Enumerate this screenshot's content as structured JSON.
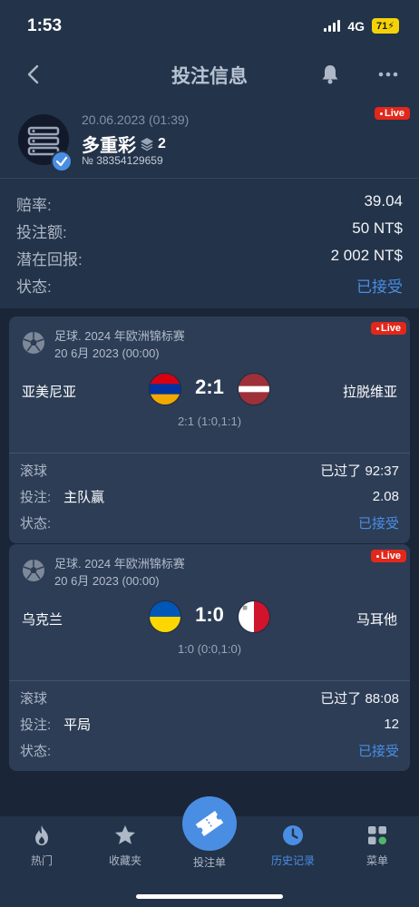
{
  "status_bar": {
    "time": "1:53",
    "network": "4G",
    "battery": "71"
  },
  "nav": {
    "title": "投注信息"
  },
  "colors": {
    "accent": "#4a8ee4",
    "live": "#e2281a",
    "background": "#1a2538",
    "panel": "#233349",
    "card": "#2d3d56"
  },
  "bet": {
    "date": "20.06.2023 (01:39)",
    "type": "多重彩",
    "count": "2",
    "number": "№ 38354129659",
    "live_label": "Live",
    "rows": [
      {
        "label": "赔率:",
        "value": "39.04"
      },
      {
        "label": "投注额:",
        "value": "50 NT$"
      },
      {
        "label": "潜在回报:",
        "value": "2 002 NT$"
      },
      {
        "label": "状态:",
        "value": "已接受"
      }
    ]
  },
  "events": [
    {
      "league": "足球. 2024 年欧洲锦标赛",
      "date": "20 6月 2023 (00:00)",
      "live_label": "Live",
      "home": "亚美尼亚",
      "away": "拉脱维亚",
      "score": "2:1",
      "score_detail": "2:1 (1:0,1:1)",
      "rows": [
        {
          "label": "滚球",
          "pick": "",
          "value": "已过了 92:37"
        },
        {
          "label": "投注:",
          "pick": "主队赢",
          "value": "2.08"
        },
        {
          "label": "状态:",
          "pick": "",
          "value": "已接受"
        }
      ]
    },
    {
      "league": "足球. 2024 年欧洲锦标赛",
      "date": "20 6月 2023 (00:00)",
      "live_label": "Live",
      "home": "乌克兰",
      "away": "马耳他",
      "score": "1:0",
      "score_detail": "1:0 (0:0,1:0)",
      "rows": [
        {
          "label": "滚球",
          "pick": "",
          "value": "已过了 88:08"
        },
        {
          "label": "投注:",
          "pick": "平局",
          "value": "12"
        },
        {
          "label": "状态:",
          "pick": "",
          "value": "已接受"
        }
      ]
    }
  ],
  "tabs": [
    {
      "label": "热门",
      "icon": "flame-icon"
    },
    {
      "label": "收藏夹",
      "icon": "star-icon"
    },
    {
      "label": "投注单",
      "icon": "ticket-icon"
    },
    {
      "label": "历史记录",
      "icon": "clock-icon"
    },
    {
      "label": "菜单",
      "icon": "grid-icon"
    }
  ]
}
